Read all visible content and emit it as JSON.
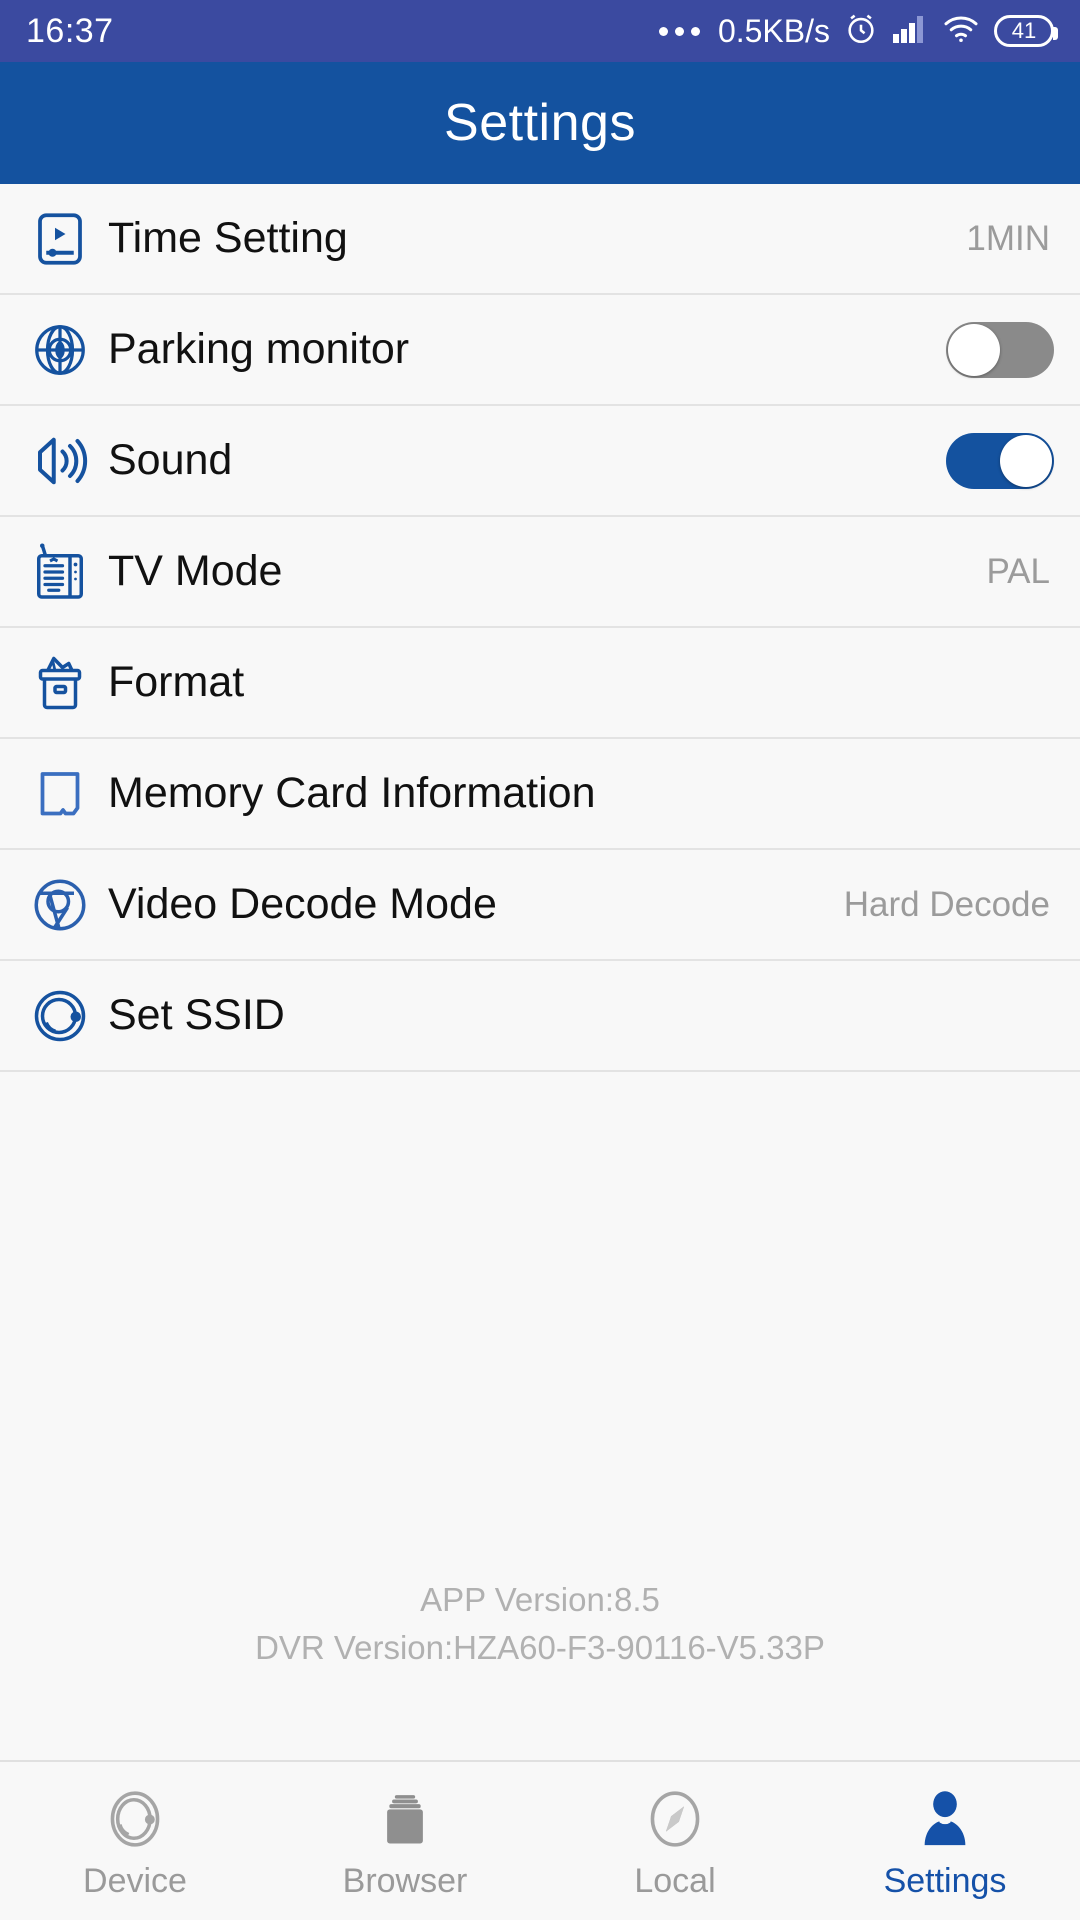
{
  "statusbar": {
    "time": "16:37",
    "network_speed": "0.5KB/s",
    "battery_level": "41",
    "icons": [
      "more-dots-icon",
      "alarm-clock-icon",
      "cellular-signal-icon",
      "wifi-icon",
      "battery-icon"
    ]
  },
  "header": {
    "title": "Settings"
  },
  "settings": {
    "rows": [
      {
        "label": "Time Setting",
        "icon": "time-setting-icon",
        "value": "1MIN",
        "control": "value"
      },
      {
        "label": "Parking monitor",
        "icon": "parking-monitor-icon",
        "value": "",
        "control": "toggle",
        "toggle_on": false
      },
      {
        "label": "Sound",
        "icon": "sound-icon",
        "value": "",
        "control": "toggle",
        "toggle_on": true
      },
      {
        "label": "TV Mode",
        "icon": "tv-mode-icon",
        "value": "PAL",
        "control": "value"
      },
      {
        "label": "Format",
        "icon": "format-icon",
        "value": "",
        "control": "none"
      },
      {
        "label": "Memory Card Information",
        "icon": "memory-card-icon",
        "value": "",
        "control": "none"
      },
      {
        "label": "Video Decode Mode",
        "icon": "video-decode-icon",
        "value": "Hard Decode",
        "control": "value"
      },
      {
        "label": "Set SSID",
        "icon": "set-ssid-icon",
        "value": "",
        "control": "none"
      }
    ]
  },
  "footer": {
    "app_version": "APP Version:8.5",
    "dvr_version": "DVR Version:HZA60-F3-90116-V5.33P"
  },
  "tabbar": {
    "items": [
      {
        "label": "Device",
        "icon": "device-icon",
        "active": false
      },
      {
        "label": "Browser",
        "icon": "browser-icon",
        "active": false
      },
      {
        "label": "Local",
        "icon": "compass-icon",
        "active": false
      },
      {
        "label": "Settings",
        "icon": "person-icon",
        "active": true
      }
    ]
  },
  "colors": {
    "statusbar_bg": "#3b4aa0",
    "appbar_bg": "#14529f",
    "accent": "#14529f",
    "page_bg": "#f8f8f8",
    "muted_text": "#9b9b9b",
    "toggle_off": "#8a8a8a"
  }
}
